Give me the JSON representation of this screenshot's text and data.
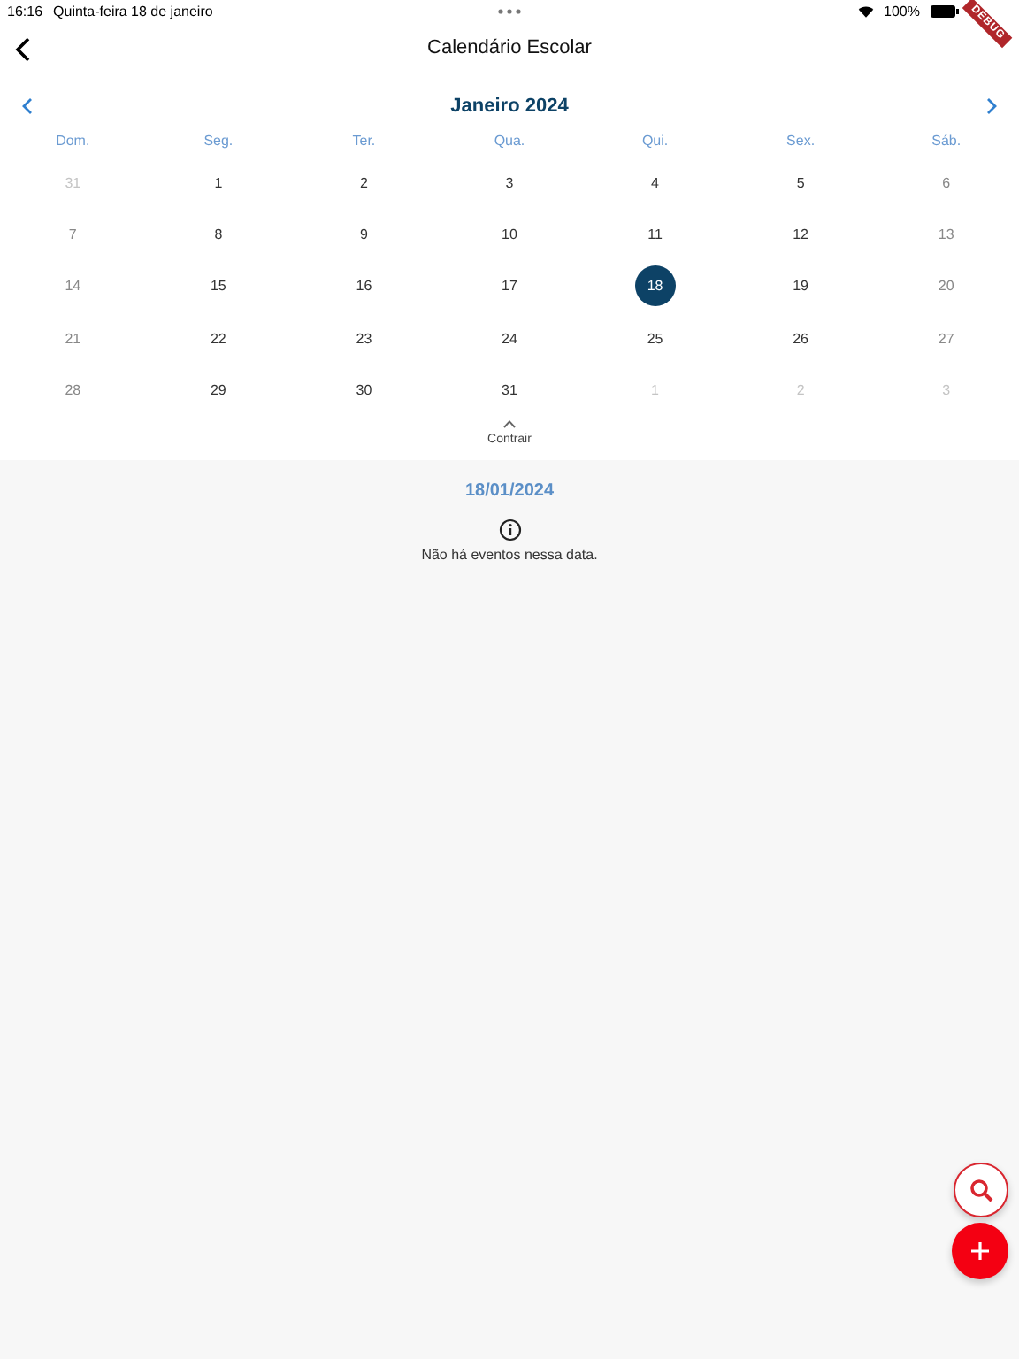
{
  "status_bar": {
    "time": "16:16",
    "date": "Quinta-feira 18 de janeiro",
    "battery": "100%"
  },
  "debug_banner": "DEBUG",
  "header": {
    "title": "Calendário Escolar"
  },
  "calendar": {
    "month": "Janeiro 2024",
    "weekdays": [
      "Dom.",
      "Seg.",
      "Ter.",
      "Qua.",
      "Qui.",
      "Sex.",
      "Sáb."
    ],
    "weeks": [
      [
        {
          "label": "31",
          "muted": true,
          "selected": false
        },
        {
          "label": "1",
          "muted": false,
          "selected": false
        },
        {
          "label": "2",
          "muted": false,
          "selected": false
        },
        {
          "label": "3",
          "muted": false,
          "selected": false
        },
        {
          "label": "4",
          "muted": false,
          "selected": false
        },
        {
          "label": "5",
          "muted": false,
          "selected": false
        },
        {
          "label": "6",
          "muted": false,
          "selected": false
        }
      ],
      [
        {
          "label": "7",
          "muted": false,
          "selected": false
        },
        {
          "label": "8",
          "muted": false,
          "selected": false
        },
        {
          "label": "9",
          "muted": false,
          "selected": false
        },
        {
          "label": "10",
          "muted": false,
          "selected": false
        },
        {
          "label": "11",
          "muted": false,
          "selected": false
        },
        {
          "label": "12",
          "muted": false,
          "selected": false
        },
        {
          "label": "13",
          "muted": false,
          "selected": false
        }
      ],
      [
        {
          "label": "14",
          "muted": false,
          "selected": false
        },
        {
          "label": "15",
          "muted": false,
          "selected": false
        },
        {
          "label": "16",
          "muted": false,
          "selected": false
        },
        {
          "label": "17",
          "muted": false,
          "selected": false
        },
        {
          "label": "18",
          "muted": false,
          "selected": true
        },
        {
          "label": "19",
          "muted": false,
          "selected": false
        },
        {
          "label": "20",
          "muted": false,
          "selected": false
        }
      ],
      [
        {
          "label": "21",
          "muted": false,
          "selected": false
        },
        {
          "label": "22",
          "muted": false,
          "selected": false
        },
        {
          "label": "23",
          "muted": false,
          "selected": false
        },
        {
          "label": "24",
          "muted": false,
          "selected": false
        },
        {
          "label": "25",
          "muted": false,
          "selected": false
        },
        {
          "label": "26",
          "muted": false,
          "selected": false
        },
        {
          "label": "27",
          "muted": false,
          "selected": false
        }
      ],
      [
        {
          "label": "28",
          "muted": false,
          "selected": false
        },
        {
          "label": "29",
          "muted": false,
          "selected": false
        },
        {
          "label": "30",
          "muted": false,
          "selected": false
        },
        {
          "label": "31",
          "muted": false,
          "selected": false
        },
        {
          "label": "1",
          "muted": true,
          "selected": false
        },
        {
          "label": "2",
          "muted": true,
          "selected": false
        },
        {
          "label": "3",
          "muted": true,
          "selected": false
        }
      ]
    ],
    "collapse_label": "Contrair"
  },
  "events": {
    "date": "18/01/2024",
    "empty_message": "Não há eventos nessa data."
  }
}
